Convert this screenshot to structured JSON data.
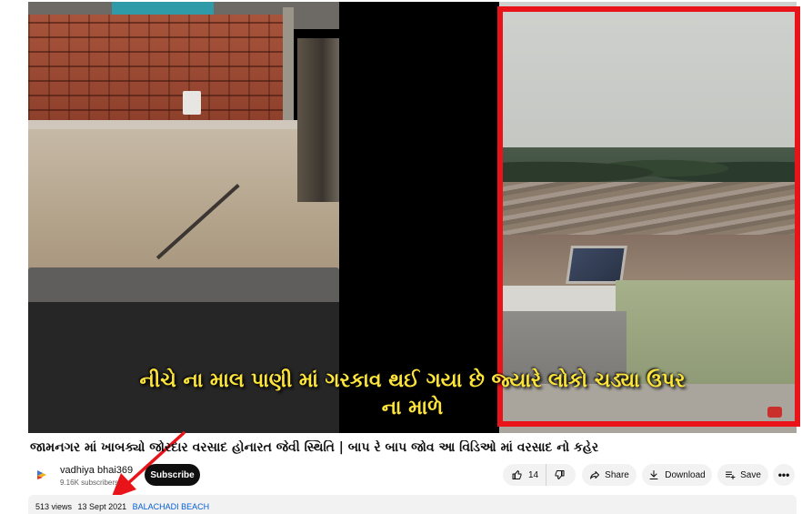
{
  "video": {
    "caption_line1": "નીચે ના માલ પાણી માં ગરકાવ થઈ ગયા છે જ્યારે લોકો ચડ્યા ઉપર",
    "caption_line2": "ના માળે"
  },
  "title": "જામનગર માં ખાબક્યો જોરદાર વરસાદ હોનારત જેવી સ્થિતિ | બાપ રે બાપ જોવ આ વિડિઓ માં વરસાદ નો કહેર",
  "channel": {
    "name": "vadhiya bhai369",
    "subscribers": "9.16K subscribers",
    "subscribe_label": "Subscribe"
  },
  "actions": {
    "like_count": "14",
    "share_label": "Share",
    "download_label": "Download",
    "save_label": "Save",
    "more_label": "•••"
  },
  "description": {
    "views": "513 views",
    "date": "13 Sept 2021",
    "hashtag": "BALACHADI BEACH"
  },
  "colors": {
    "highlight_box": "#e8141a",
    "caption_text": "#fde43a",
    "link": "#065fd4"
  }
}
